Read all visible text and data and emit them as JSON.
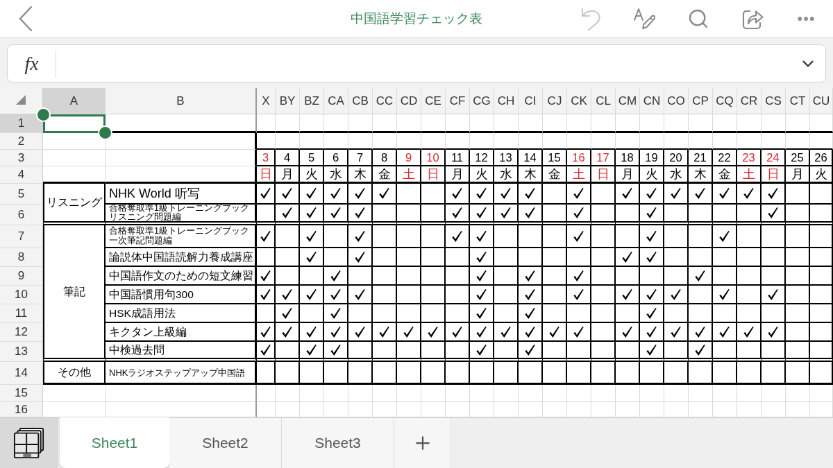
{
  "top_bar": {
    "title": "中国語学習チェック表"
  },
  "formula_bar": {
    "function_label": "fx"
  },
  "sheet": {
    "columns": [
      {
        "label": "A",
        "selected": true
      },
      {
        "label": "B",
        "selected": false
      },
      {
        "label": "X",
        "selected": false
      },
      {
        "label": "BY",
        "selected": false
      },
      {
        "label": "BZ",
        "selected": false
      },
      {
        "label": "CA",
        "selected": false
      },
      {
        "label": "CB",
        "selected": false
      },
      {
        "label": "CC",
        "selected": false
      },
      {
        "label": "CD",
        "selected": false
      },
      {
        "label": "CE",
        "selected": false
      },
      {
        "label": "CF",
        "selected": false
      },
      {
        "label": "CG",
        "selected": false
      },
      {
        "label": "CH",
        "selected": false
      },
      {
        "label": "CI",
        "selected": false
      },
      {
        "label": "CJ",
        "selected": false
      },
      {
        "label": "CK",
        "selected": false
      },
      {
        "label": "CL",
        "selected": false
      },
      {
        "label": "CM",
        "selected": false
      },
      {
        "label": "CN",
        "selected": false
      },
      {
        "label": "CO",
        "selected": false
      },
      {
        "label": "CP",
        "selected": false
      },
      {
        "label": "CQ",
        "selected": false
      },
      {
        "label": "CR",
        "selected": false
      },
      {
        "label": "CS",
        "selected": false
      },
      {
        "label": "CT",
        "selected": false
      },
      {
        "label": "CU",
        "selected": false
      }
    ],
    "rows": [
      {
        "label": "1",
        "selected": true
      },
      {
        "label": "2",
        "selected": false
      },
      {
        "label": "3",
        "selected": false
      },
      {
        "label": "4",
        "selected": false
      },
      {
        "label": "5",
        "selected": false
      },
      {
        "label": "6",
        "selected": false
      },
      {
        "label": "7",
        "selected": false
      },
      {
        "label": "8",
        "selected": false
      },
      {
        "label": "9",
        "selected": false
      },
      {
        "label": "10",
        "selected": false
      },
      {
        "label": "11",
        "selected": false
      },
      {
        "label": "12",
        "selected": false
      },
      {
        "label": "13",
        "selected": false
      },
      {
        "label": "14",
        "selected": false
      },
      {
        "label": "15",
        "selected": false
      },
      {
        "label": "16",
        "selected": false
      }
    ],
    "dates": [
      {
        "day": "3",
        "weekday": "日",
        "weekend": true
      },
      {
        "day": "4",
        "weekday": "月",
        "weekend": false
      },
      {
        "day": "5",
        "weekday": "火",
        "weekend": false
      },
      {
        "day": "6",
        "weekday": "水",
        "weekend": false
      },
      {
        "day": "7",
        "weekday": "木",
        "weekend": false
      },
      {
        "day": "8",
        "weekday": "金",
        "weekend": false
      },
      {
        "day": "9",
        "weekday": "土",
        "weekend": true
      },
      {
        "day": "10",
        "weekday": "日",
        "weekend": true
      },
      {
        "day": "11",
        "weekday": "月",
        "weekend": false
      },
      {
        "day": "12",
        "weekday": "火",
        "weekend": false
      },
      {
        "day": "13",
        "weekday": "水",
        "weekend": false
      },
      {
        "day": "14",
        "weekday": "木",
        "weekend": false
      },
      {
        "day": "15",
        "weekday": "金",
        "weekend": false
      },
      {
        "day": "16",
        "weekday": "土",
        "weekend": true
      },
      {
        "day": "17",
        "weekday": "日",
        "weekend": true
      },
      {
        "day": "18",
        "weekday": "月",
        "weekend": false
      },
      {
        "day": "19",
        "weekday": "火",
        "weekend": false
      },
      {
        "day": "20",
        "weekday": "水",
        "weekend": false
      },
      {
        "day": "21",
        "weekday": "木",
        "weekend": false
      },
      {
        "day": "22",
        "weekday": "金",
        "weekend": false
      },
      {
        "day": "23",
        "weekday": "土",
        "weekend": true
      },
      {
        "day": "24",
        "weekday": "日",
        "weekend": true
      },
      {
        "day": "25",
        "weekday": "月",
        "weekend": false
      },
      {
        "day": "26",
        "weekday": "火",
        "weekend": false
      }
    ],
    "categories": [
      {
        "label": "リスニング",
        "items": [
          {
            "lines": [
              "NHK World 听写"
            ],
            "cells": [
              {
                "checked": true
              },
              {
                "checked": true
              },
              {
                "checked": true
              },
              {
                "checked": true
              },
              {
                "checked": true
              },
              {
                "checked": true
              },
              {
                "checked": false
              },
              {
                "checked": false
              },
              {
                "checked": true
              },
              {
                "checked": true
              },
              {
                "checked": true
              },
              {
                "checked": true
              },
              {
                "checked": false
              },
              {
                "checked": true
              },
              {
                "checked": false
              },
              {
                "checked": true
              },
              {
                "checked": true
              },
              {
                "checked": true
              },
              {
                "checked": true
              },
              {
                "checked": true
              },
              {
                "checked": true
              },
              {
                "checked": true
              },
              {
                "checked": false
              },
              {
                "checked": false
              }
            ]
          },
          {
            "lines": [
              "合格奪取準1級トレーニングブック",
              "リスニング問題編"
            ],
            "cells": [
              {
                "checked": false
              },
              {
                "checked": true
              },
              {
                "checked": true
              },
              {
                "checked": true
              },
              {
                "checked": true
              },
              {
                "checked": false
              },
              {
                "checked": false
              },
              {
                "checked": false
              },
              {
                "checked": true
              },
              {
                "checked": true
              },
              {
                "checked": true
              },
              {
                "checked": true
              },
              {
                "checked": false
              },
              {
                "checked": true
              },
              {
                "checked": false
              },
              {
                "checked": false
              },
              {
                "checked": true
              },
              {
                "checked": false
              },
              {
                "checked": false
              },
              {
                "checked": false
              },
              {
                "checked": false
              },
              {
                "checked": true
              },
              {
                "checked": false
              },
              {
                "checked": false
              }
            ]
          }
        ]
      },
      {
        "label": "筆記",
        "items": [
          {
            "lines": [
              "合格奪取準1級トレーニングブック",
              "一次筆記問題編"
            ],
            "cells": [
              {
                "checked": true
              },
              {
                "checked": false
              },
              {
                "checked": true
              },
              {
                "checked": false
              },
              {
                "checked": true
              },
              {
                "checked": false
              },
              {
                "checked": false
              },
              {
                "checked": false
              },
              {
                "checked": true
              },
              {
                "checked": true
              },
              {
                "checked": false
              },
              {
                "checked": false
              },
              {
                "checked": false
              },
              {
                "checked": true
              },
              {
                "checked": false
              },
              {
                "checked": false
              },
              {
                "checked": true
              },
              {
                "checked": false
              },
              {
                "checked": false
              },
              {
                "checked": true
              },
              {
                "checked": false
              },
              {
                "checked": false
              },
              {
                "checked": false
              },
              {
                "checked": false
              }
            ]
          },
          {
            "lines": [
              "論説体中国語読解力養成講座"
            ],
            "cells": [
              {
                "checked": false
              },
              {
                "checked": false
              },
              {
                "checked": true
              },
              {
                "checked": false
              },
              {
                "checked": true
              },
              {
                "checked": false
              },
              {
                "checked": false
              },
              {
                "checked": false
              },
              {
                "checked": false
              },
              {
                "checked": true
              },
              {
                "checked": false
              },
              {
                "checked": false
              },
              {
                "checked": false
              },
              {
                "checked": false
              },
              {
                "checked": false
              },
              {
                "checked": true
              },
              {
                "checked": true
              },
              {
                "checked": false
              },
              {
                "checked": false
              },
              {
                "checked": false
              },
              {
                "checked": false
              },
              {
                "checked": false
              },
              {
                "checked": false
              },
              {
                "checked": false
              }
            ]
          },
          {
            "lines": [
              "中国語作文のための短文練習"
            ],
            "cells": [
              {
                "checked": true
              },
              {
                "checked": false
              },
              {
                "checked": false
              },
              {
                "checked": true
              },
              {
                "checked": false
              },
              {
                "checked": false
              },
              {
                "checked": false
              },
              {
                "checked": false
              },
              {
                "checked": false
              },
              {
                "checked": true
              },
              {
                "checked": false
              },
              {
                "checked": true
              },
              {
                "checked": false
              },
              {
                "checked": true
              },
              {
                "checked": false
              },
              {
                "checked": false
              },
              {
                "checked": false
              },
              {
                "checked": false
              },
              {
                "checked": true
              },
              {
                "checked": false
              },
              {
                "checked": false
              },
              {
                "checked": false
              },
              {
                "checked": false
              },
              {
                "checked": false
              }
            ]
          },
          {
            "lines": [
              "中国語慣用句300"
            ],
            "cells": [
              {
                "checked": true
              },
              {
                "checked": true
              },
              {
                "checked": true
              },
              {
                "checked": true
              },
              {
                "checked": true
              },
              {
                "checked": false
              },
              {
                "checked": false
              },
              {
                "checked": false
              },
              {
                "checked": false
              },
              {
                "checked": true
              },
              {
                "checked": false
              },
              {
                "checked": true
              },
              {
                "checked": false
              },
              {
                "checked": true
              },
              {
                "checked": false
              },
              {
                "checked": true
              },
              {
                "checked": true
              },
              {
                "checked": true
              },
              {
                "checked": false
              },
              {
                "checked": true
              },
              {
                "checked": false
              },
              {
                "checked": true
              },
              {
                "checked": false
              },
              {
                "checked": false
              }
            ]
          },
          {
            "lines": [
              "HSK成語用法"
            ],
            "cells": [
              {
                "checked": false
              },
              {
                "checked": true
              },
              {
                "checked": false
              },
              {
                "checked": true
              },
              {
                "checked": false
              },
              {
                "checked": false
              },
              {
                "checked": false
              },
              {
                "checked": false
              },
              {
                "checked": false
              },
              {
                "checked": true
              },
              {
                "checked": false
              },
              {
                "checked": true
              },
              {
                "checked": false
              },
              {
                "checked": false
              },
              {
                "checked": false
              },
              {
                "checked": false
              },
              {
                "checked": true
              },
              {
                "checked": false
              },
              {
                "checked": false
              },
              {
                "checked": false
              },
              {
                "checked": false
              },
              {
                "checked": false
              },
              {
                "checked": false
              },
              {
                "checked": false
              }
            ]
          },
          {
            "lines": [
              "キクタン上級編"
            ],
            "cells": [
              {
                "checked": true
              },
              {
                "checked": true
              },
              {
                "checked": true
              },
              {
                "checked": true
              },
              {
                "checked": true
              },
              {
                "checked": true
              },
              {
                "checked": true
              },
              {
                "checked": true
              },
              {
                "checked": true
              },
              {
                "checked": true
              },
              {
                "checked": true
              },
              {
                "checked": true
              },
              {
                "checked": true
              },
              {
                "checked": true
              },
              {
                "checked": false
              },
              {
                "checked": true
              },
              {
                "checked": true
              },
              {
                "checked": true
              },
              {
                "checked": true
              },
              {
                "checked": true
              },
              {
                "checked": true
              },
              {
                "checked": true
              },
              {
                "checked": false
              },
              {
                "checked": false
              }
            ]
          },
          {
            "lines": [
              "中検過去問"
            ],
            "cells": [
              {
                "checked": true
              },
              {
                "checked": false
              },
              {
                "checked": true
              },
              {
                "checked": true
              },
              {
                "checked": false
              },
              {
                "checked": false
              },
              {
                "checked": false
              },
              {
                "checked": false
              },
              {
                "checked": false
              },
              {
                "checked": true
              },
              {
                "checked": false
              },
              {
                "checked": true
              },
              {
                "checked": false
              },
              {
                "checked": false
              },
              {
                "checked": false
              },
              {
                "checked": false
              },
              {
                "checked": true
              },
              {
                "checked": false
              },
              {
                "checked": true
              },
              {
                "checked": false
              },
              {
                "checked": false
              },
              {
                "checked": false
              },
              {
                "checked": false
              },
              {
                "checked": false
              }
            ]
          }
        ]
      },
      {
        "label": "その他",
        "items": [
          {
            "lines": [
              "NHKラジオステップアップ中国語"
            ],
            "cells": [
              {
                "checked": false
              },
              {
                "checked": false
              },
              {
                "checked": false
              },
              {
                "checked": false
              },
              {
                "checked": false
              },
              {
                "checked": false
              },
              {
                "checked": false
              },
              {
                "checked": false
              },
              {
                "checked": false
              },
              {
                "checked": false
              },
              {
                "checked": false
              },
              {
                "checked": false
              },
              {
                "checked": false
              },
              {
                "checked": false
              },
              {
                "checked": false
              },
              {
                "checked": false
              },
              {
                "checked": false
              },
              {
                "checked": false
              },
              {
                "checked": false
              },
              {
                "checked": false
              },
              {
                "checked": false
              },
              {
                "checked": false
              },
              {
                "checked": false
              },
              {
                "checked": false
              }
            ]
          }
        ]
      }
    ]
  },
  "sheet_tabs": [
    {
      "label": "Sheet1",
      "selected": true
    },
    {
      "label": "Sheet2",
      "selected": false
    },
    {
      "label": "Sheet3",
      "selected": false
    }
  ]
}
